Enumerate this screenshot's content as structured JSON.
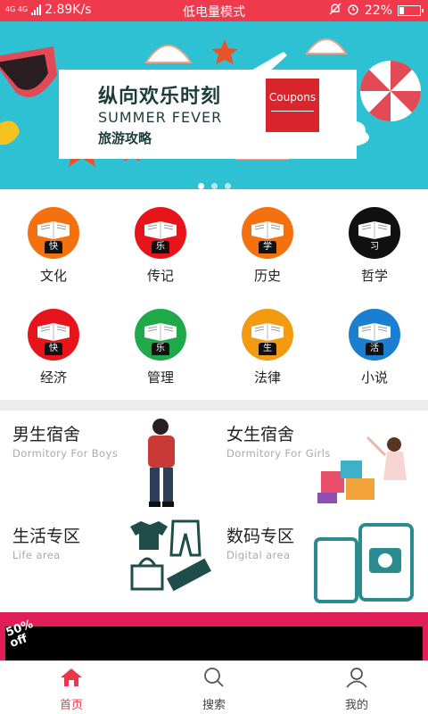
{
  "status_bar": {
    "network": "4G 4G",
    "speed": "2.89K/s",
    "mode": "低电量模式",
    "battery": "22%",
    "battery_level": 0.22
  },
  "banner": {
    "title": "纵向欢乐时刻",
    "subtitle": "SUMMER FEVER",
    "caption": "旅游攻略",
    "coupon": "Coupons",
    "page_count": 3,
    "active_page": 1
  },
  "categories": [
    {
      "label": "文化",
      "badge": "快",
      "color": "#f5710f"
    },
    {
      "label": "传记",
      "badge": "乐",
      "color": "#e8141c"
    },
    {
      "label": "历史",
      "badge": "学",
      "color": "#f5710f"
    },
    {
      "label": "哲学",
      "badge": "习",
      "color": "#111111"
    },
    {
      "label": "经济",
      "badge": "快",
      "color": "#e8141c"
    },
    {
      "label": "管理",
      "badge": "乐",
      "color": "#1fa94b"
    },
    {
      "label": "法律",
      "badge": "生",
      "color": "#f29a12"
    },
    {
      "label": "小说",
      "badge": "活",
      "color": "#1a7fd1"
    }
  ],
  "zones": [
    {
      "title": "男生宿舍",
      "subtitle": "Dormitory For Boys"
    },
    {
      "title": "女生宿舍",
      "subtitle": "Dormitory For Girls"
    },
    {
      "title": "生活专区",
      "subtitle": "Life area"
    },
    {
      "title": "数码专区",
      "subtitle": "Digital area"
    }
  ],
  "promo": {
    "badge_line1": "50%",
    "badge_line2": "off"
  },
  "tabs": [
    {
      "label": "首页",
      "icon": "home-icon",
      "active": true
    },
    {
      "label": "搜索",
      "icon": "search-icon",
      "active": false
    },
    {
      "label": "我的",
      "icon": "user-icon",
      "active": false
    }
  ],
  "colors": {
    "accent": "#ef3a4d",
    "banner_bg": "#2ec1d3",
    "promo": "#e11d58"
  }
}
